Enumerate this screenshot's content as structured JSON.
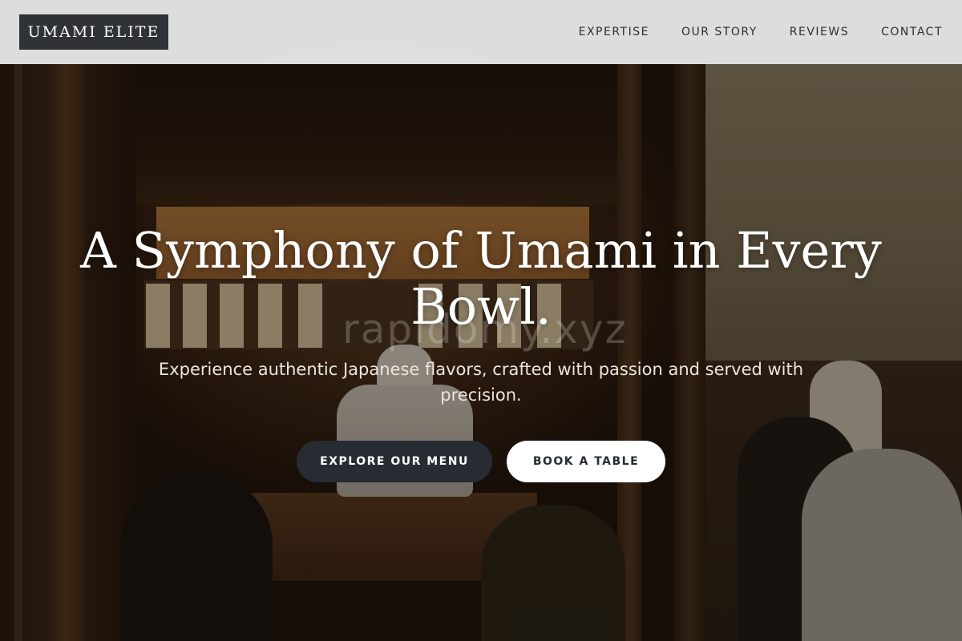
{
  "header": {
    "logo": "UMAMI ELITE",
    "nav": [
      {
        "label": "EXPERTISE"
      },
      {
        "label": "OUR STORY"
      },
      {
        "label": "REVIEWS"
      },
      {
        "label": "CONTACT"
      }
    ]
  },
  "hero": {
    "title": "A Symphony of Umami in Every Bowl.",
    "subtitle": "Experience authentic Japanese flavors, crafted with passion and served with precision.",
    "watermark": "rapidomy.xyz",
    "primary_cta": "EXPLORE OUR MENU",
    "secondary_cta": "BOOK A TABLE"
  },
  "colors": {
    "header_bg": "#ebebeb",
    "logo_bg": "#2f3337",
    "primary_button": "#272c33",
    "secondary_button": "#ffffff"
  }
}
